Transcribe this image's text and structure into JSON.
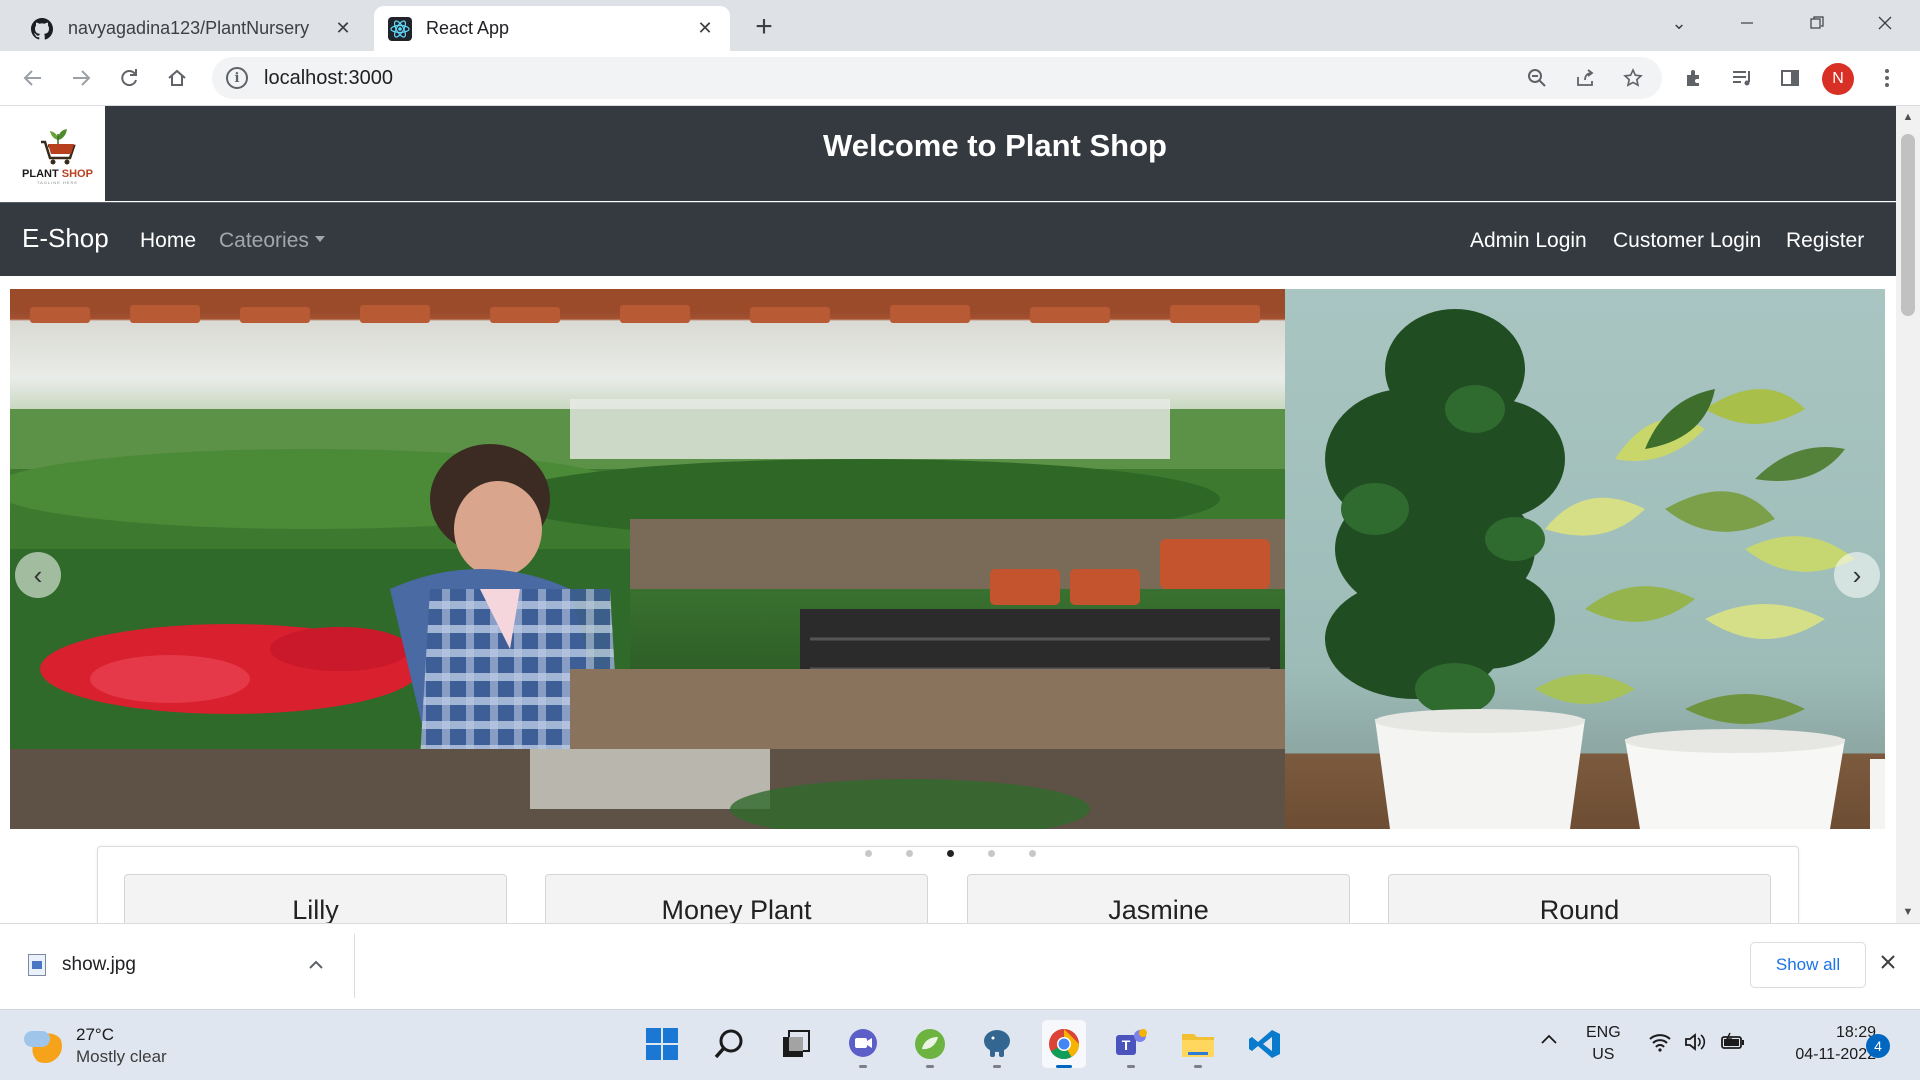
{
  "browser": {
    "tabs": [
      {
        "title": "navyagadina123/PlantNursery",
        "icon": "github-icon"
      },
      {
        "title": "React App",
        "icon": "react-icon"
      }
    ],
    "url": "localhost:3000"
  },
  "page": {
    "header_title": "Welcome to Plant Shop",
    "logo": {
      "line1": "PLANT",
      "line2": " SHOP",
      "tagline": "TAGLINE HERE"
    },
    "navbar": {
      "brand": "E-Shop",
      "home": "Home",
      "categories": "Cateories",
      "admin_login": "Admin Login",
      "customer_login": "Customer Login",
      "register": "Register"
    },
    "carousel": {
      "slide_count": 5,
      "active_index": 2
    },
    "cards": [
      "Lilly",
      "Money Plant",
      "Jasmine",
      "Round"
    ]
  },
  "downloads": {
    "file": "show.jpg",
    "show_all": "Show all"
  },
  "taskbar": {
    "weather_temp": "27°C",
    "weather_cond": "Mostly clear",
    "lang1": "ENG",
    "lang2": "US",
    "time": "18:29",
    "date": "04-11-2022",
    "notifications": "4"
  }
}
